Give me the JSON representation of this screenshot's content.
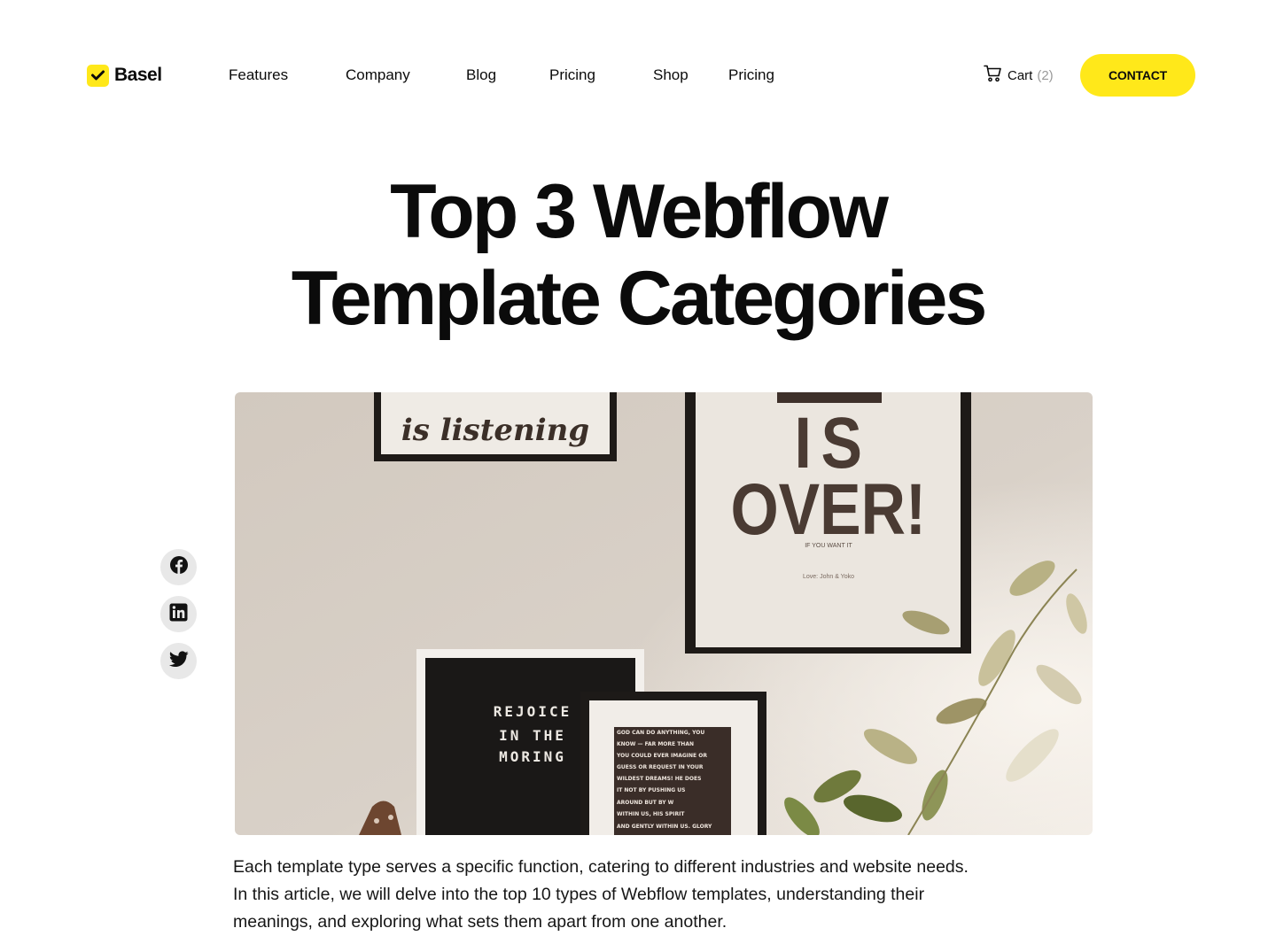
{
  "brand": {
    "name": "Basel",
    "accent": "#ffe81a",
    "icon": "checkmark-icon"
  },
  "nav": {
    "items": [
      {
        "label": "Features"
      },
      {
        "label": "Company"
      },
      {
        "label": "Blog"
      },
      {
        "label": "Pricing"
      },
      {
        "label": "Shop"
      },
      {
        "label": "Pricing"
      }
    ],
    "cart": {
      "label": "Cart",
      "count": "(2)",
      "icon": "cart-icon"
    },
    "contact_label": "CONTACT"
  },
  "article": {
    "title_line1": "Top 3 Webflow",
    "title_line2": "Template Categories",
    "intro": "Each template type serves a specific function, catering to different industries and website needs. In this article, we will delve into the top 10 types of Webflow templates, understanding their meanings, and exploring what sets them apart from one another."
  },
  "share": [
    {
      "icon": "facebook-icon"
    },
    {
      "icon": "linkedin-icon"
    },
    {
      "icon": "twitter-icon"
    }
  ],
  "hero_image": {
    "poster_top_text": "is listening",
    "poster_right_line1": "IS",
    "poster_right_line2": "OVER!",
    "poster_right_small1": "IF YOU WANT IT",
    "poster_right_small2": "Love: John & Yoko",
    "letterboard_line1": "REJOICE",
    "letterboard_line2": "IN THE",
    "letterboard_line3": "MORING",
    "small_frame_lines": [
      "GOD CAN DO ANYTHING, YOU",
      "KNOW — FAR MORE THAN",
      "YOU COULD EVER IMAGINE OR",
      "GUESS OR REQUEST IN YOUR",
      "WILDEST DREAMS! HE DOES",
      "IT NOT BY PUSHING US",
      "AROUND BUT BY W",
      "WITHIN US, HIS SPIRIT",
      "AND GENTLY WITHIN US. GLORY"
    ]
  }
}
